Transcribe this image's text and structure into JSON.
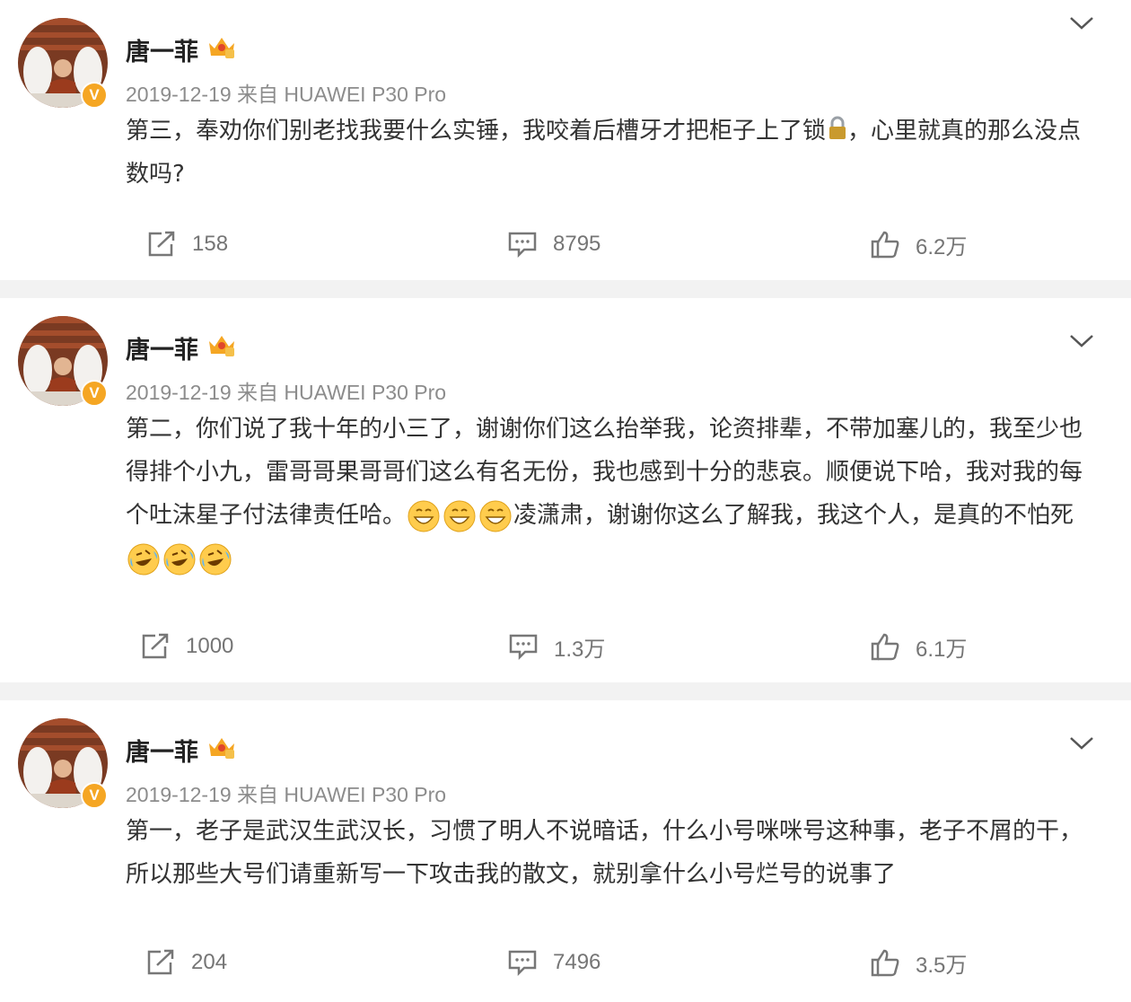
{
  "posts": [
    {
      "author": "唐一菲",
      "meta": "2019-12-19 来自 HUAWEI P30 Pro",
      "text_before": "第三，奉劝你们别老找我要什么实锤，我咬着后槽牙才把柜子上了锁",
      "text_after": "，心里就真的那么没点　数吗?",
      "repost_count": "158",
      "comment_count": "8795",
      "like_count": "6.2万"
    },
    {
      "author": "唐一菲",
      "meta": "2019-12-19 来自 HUAWEI P30 Pro",
      "text_before": "第二，你们说了我十年的小三了，谢谢你们这么抬举我，论资排辈，不带加塞儿的，我至少也得排个小九，雷哥哥果哥哥们这么有名无份，我也感到十分的悲哀。顺便说下哈，我对我的每个吐沫星子付法律责任哈。",
      "text_middle": "凌潇肃，谢谢你这么了解我，我这个人，是真的不怕死",
      "repost_count": "1000",
      "comment_count": "1.3万",
      "like_count": "6.1万"
    },
    {
      "author": "唐一菲",
      "meta": "2019-12-19 来自 HUAWEI P30 Pro",
      "text_before": "第一，老子是武汉生武汉长，习惯了明人不说暗话，什么小号咪咪号这种事，老子不屑的干，所以那些大号们请重新写一下攻击我的散文，就别拿什么小号烂号的说事了",
      "repost_count": "204",
      "comment_count": "7496",
      "like_count": "3.5万"
    }
  ],
  "badge": {
    "verified_letter": "V",
    "verified_color": "#f5a623"
  },
  "icons": {
    "chevron": "chevron-down-icon",
    "repost": "repost-icon",
    "comment": "comment-icon",
    "like": "thumbs-up-icon",
    "crown": "crown-icon",
    "lock": "lock-icon",
    "grin": "grinning-emoji",
    "laugh": "laughing-crying-emoji"
  }
}
